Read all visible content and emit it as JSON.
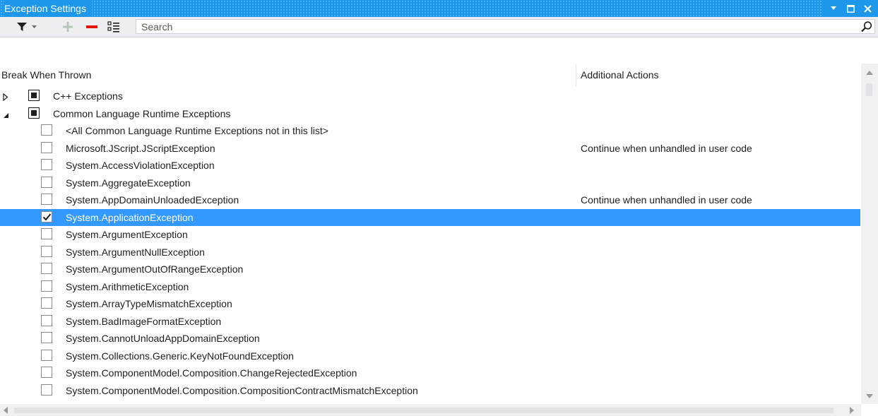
{
  "window": {
    "title": "Exception Settings"
  },
  "toolbar": {
    "filter_icon": "filter-icon",
    "add_icon": "plus-icon",
    "remove_icon": "minus-icon",
    "restore_icon": "restore-defaults-icon",
    "search_placeholder": "Search"
  },
  "columns": {
    "break_when_thrown": "Break When Thrown",
    "additional_actions": "Additional Actions"
  },
  "colors": {
    "title_bar": "#1c97ea",
    "selection": "#3399ff",
    "remove_red": "#e51400"
  },
  "rows": [
    {
      "label": "C++ Exceptions",
      "expander": "collapsed",
      "check": "partial",
      "action": "",
      "level": 0
    },
    {
      "label": "Common Language Runtime Exceptions",
      "expander": "expanded",
      "check": "partial",
      "action": "",
      "level": 0
    },
    {
      "label": "<All Common Language Runtime Exceptions not in this list>",
      "check": "unchecked",
      "action": "",
      "level": 1
    },
    {
      "label": "Microsoft.JScript.JScriptException",
      "check": "unchecked",
      "action": "Continue when unhandled in user code",
      "level": 1
    },
    {
      "label": "System.AccessViolationException",
      "check": "unchecked",
      "action": "",
      "level": 1
    },
    {
      "label": "System.AggregateException",
      "check": "unchecked",
      "action": "",
      "level": 1
    },
    {
      "label": "System.AppDomainUnloadedException",
      "check": "unchecked",
      "action": "Continue when unhandled in user code",
      "level": 1
    },
    {
      "label": "System.ApplicationException",
      "check": "checked",
      "action": "",
      "level": 1,
      "selected": true
    },
    {
      "label": "System.ArgumentException",
      "check": "unchecked",
      "action": "",
      "level": 1
    },
    {
      "label": "System.ArgumentNullException",
      "check": "unchecked",
      "action": "",
      "level": 1
    },
    {
      "label": "System.ArgumentOutOfRangeException",
      "check": "unchecked",
      "action": "",
      "level": 1
    },
    {
      "label": "System.ArithmeticException",
      "check": "unchecked",
      "action": "",
      "level": 1
    },
    {
      "label": "System.ArrayTypeMismatchException",
      "check": "unchecked",
      "action": "",
      "level": 1
    },
    {
      "label": "System.BadImageFormatException",
      "check": "unchecked",
      "action": "",
      "level": 1
    },
    {
      "label": "System.CannotUnloadAppDomainException",
      "check": "unchecked",
      "action": "",
      "level": 1
    },
    {
      "label": "System.Collections.Generic.KeyNotFoundException",
      "check": "unchecked",
      "action": "",
      "level": 1
    },
    {
      "label": "System.ComponentModel.Composition.ChangeRejectedException",
      "check": "unchecked",
      "action": "",
      "level": 1
    },
    {
      "label": "System.ComponentModel.Composition.CompositionContractMismatchException",
      "check": "unchecked",
      "action": "",
      "level": 1
    }
  ]
}
